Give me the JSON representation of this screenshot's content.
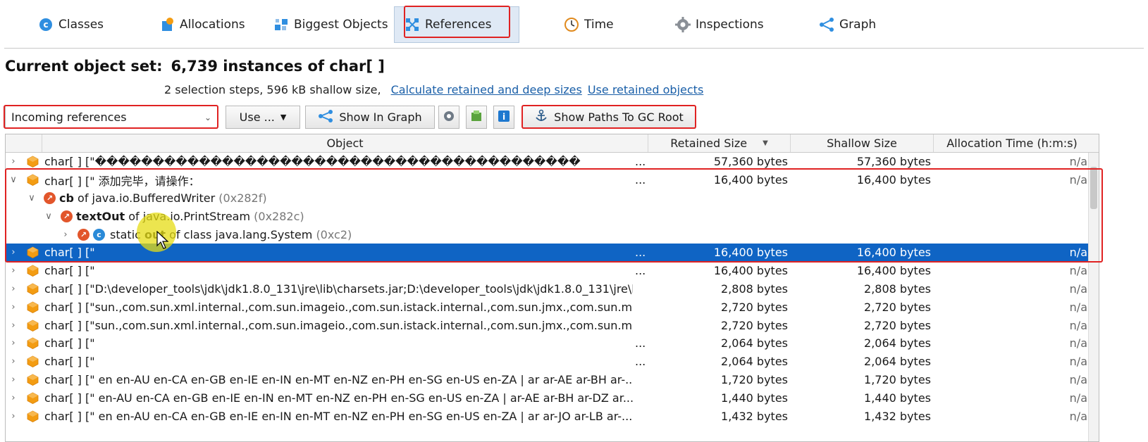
{
  "tabs": [
    {
      "label": "Classes",
      "icon": "classes-icon"
    },
    {
      "label": "Allocations",
      "icon": "allocations-icon"
    },
    {
      "label": "Biggest Objects",
      "icon": "biggest-objects-icon"
    },
    {
      "label": "References",
      "icon": "references-icon",
      "active": true
    },
    {
      "label": "Time",
      "icon": "clock-icon"
    },
    {
      "label": "Inspections",
      "icon": "gear-icon"
    },
    {
      "label": "Graph",
      "icon": "graph-icon"
    }
  ],
  "header": {
    "label": "Current object set:",
    "value": "6,739 instances of char[ ]",
    "steps": "2 selection steps, 596 kB shallow size,",
    "link_calc": "Calculate retained and deep sizes",
    "link_use": "Use retained objects"
  },
  "toolbar": {
    "combo_value": "Incoming references",
    "use_label": "Use ...",
    "graph_label": "Show In Graph",
    "gc_label": "Show Paths To GC Root"
  },
  "columns": {
    "object": "Object",
    "retained": "Retained Size",
    "shallow": "Shallow Size",
    "alloc": "Allocation Time (h:m:s)"
  },
  "rows": [
    {
      "type": "obj",
      "text": "char[ ] [\"\u0000\u0000\u0000\u0000\u0000\u0000\u0000\u0000\u0000\u0000\u0000\u0000\u0000\u0000\u0000\u0000\u0000\u0000\u0000\u0000\u0000\u0000\u0000\u0000\u0000\u0000\u0000\u0000\u0000\u0000\u0000\u0000\u0000\u0000\u0000\u0000\u0000\u0000\u0000\u0000\u0000\u0000",
      "dots": "...",
      "retained": "57,360 bytes",
      "shallow": "57,360 bytes",
      "alloc": "n/a",
      "expanded": false
    },
    {
      "type": "obj",
      "text": "char[ ] [\" 添加完毕，请操作：",
      "dots": "...",
      "retained": "16,400 bytes",
      "shallow": "16,400 bytes",
      "alloc": "n/a",
      "expanded": true
    },
    {
      "type": "ref1",
      "name": "cb",
      "rest": " of java.io.BufferedWriter ",
      "hex": "(0x282f)"
    },
    {
      "type": "ref2",
      "name": "textOut",
      "rest": " of java.io.PrintStream ",
      "hex": "(0x282c)"
    },
    {
      "type": "ref3",
      "pre": "static ",
      "name": "out",
      "rest": " of class java.lang.System ",
      "hex": "(0xc2)"
    },
    {
      "type": "obj",
      "text": "char[ ] [\"",
      "dots": "...",
      "retained": "16,400 bytes",
      "shallow": "16,400 bytes",
      "alloc": "n/a",
      "selected": true
    },
    {
      "type": "obj",
      "text": "char[ ] [\"",
      "dots": "...",
      "retained": "16,400 bytes",
      "shallow": "16,400 bytes",
      "alloc": "n/a"
    },
    {
      "type": "obj",
      "text": "char[ ] [\"D:\\developer_tools\\jdk\\jdk1.8.0_131\\jre\\lib\\charsets.jar;D:\\developer_tools\\jdk\\jdk1.8.0_131\\jre\\lib...",
      "dots": "",
      "retained": "2,808 bytes",
      "shallow": "2,808 bytes",
      "alloc": "n/a"
    },
    {
      "type": "obj",
      "text": "char[ ] [\"sun.,com.sun.xml.internal.,com.sun.imageio.,com.sun.istack.internal.,com.sun.jmx.,com.sun.media.so...",
      "dots": "",
      "retained": "2,720 bytes",
      "shallow": "2,720 bytes",
      "alloc": "n/a"
    },
    {
      "type": "obj",
      "text": "char[ ] [\"sun.,com.sun.xml.internal.,com.sun.imageio.,com.sun.istack.internal.,com.sun.jmx.,com.sun.media.so...",
      "dots": "",
      "retained": "2,720 bytes",
      "shallow": "2,720 bytes",
      "alloc": "n/a"
    },
    {
      "type": "obj",
      "text": "char[ ] [\"",
      "dots": "...",
      "retained": "2,064 bytes",
      "shallow": "2,064 bytes",
      "alloc": "n/a"
    },
    {
      "type": "obj",
      "text": "char[ ] [\"",
      "dots": "...",
      "retained": "2,064 bytes",
      "shallow": "2,064 bytes",
      "alloc": "n/a"
    },
    {
      "type": "obj",
      "text": "char[ ] [\" en en-AU en-CA en-GB en-IE en-IN en-MT en-NZ en-PH en-SG en-US en-ZA | ar ar-AE ar-BH ar-...",
      "dots": "",
      "retained": "1,720 bytes",
      "shallow": "1,720 bytes",
      "alloc": "n/a"
    },
    {
      "type": "obj",
      "text": "char[ ] [\"  en-AU en-CA en-GB en-IE en-IN en-MT en-NZ en-PH en-SG en-US en-ZA |  ar-AE ar-BH ar-DZ ar...",
      "dots": "",
      "retained": "1,440 bytes",
      "shallow": "1,440 bytes",
      "alloc": "n/a"
    },
    {
      "type": "obj",
      "text": "char[ ] [\"  en en-AU en-CA en-GB en-IE en-IN en-MT en-NZ en-PH en-SG en-US en-ZA |  ar ar-JO ar-LB ar-...",
      "dots": "",
      "retained": "1,432 bytes",
      "shallow": "1,432 bytes",
      "alloc": "n/a"
    }
  ]
}
